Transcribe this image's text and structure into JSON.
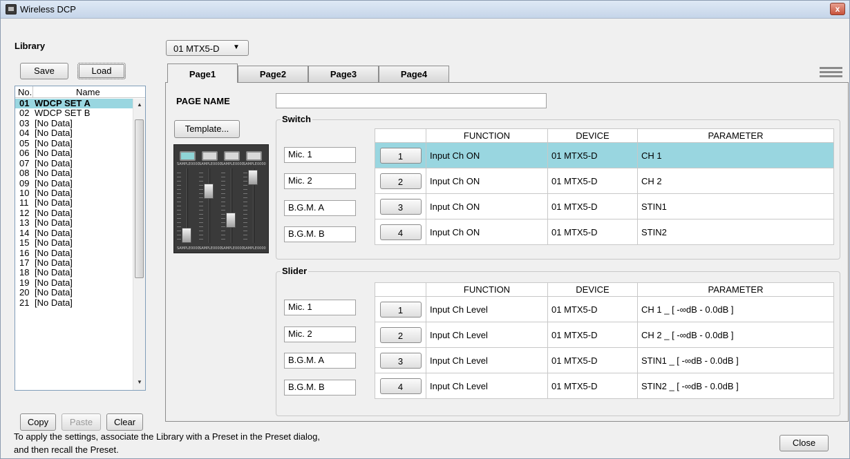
{
  "window": {
    "title": "Wireless DCP",
    "close_glyph": "x"
  },
  "library": {
    "label": "Library",
    "save_label": "Save",
    "load_label": "Load",
    "columns": {
      "no": "No.",
      "name": "Name"
    },
    "items": [
      {
        "no": "01",
        "name": "WDCP SET A"
      },
      {
        "no": "02",
        "name": "WDCP SET B"
      },
      {
        "no": "03",
        "name": "[No Data]"
      },
      {
        "no": "04",
        "name": "[No Data]"
      },
      {
        "no": "05",
        "name": "[No Data]"
      },
      {
        "no": "06",
        "name": "[No Data]"
      },
      {
        "no": "07",
        "name": "[No Data]"
      },
      {
        "no": "08",
        "name": "[No Data]"
      },
      {
        "no": "09",
        "name": "[No Data]"
      },
      {
        "no": "10",
        "name": "[No Data]"
      },
      {
        "no": "11",
        "name": "[No Data]"
      },
      {
        "no": "12",
        "name": "[No Data]"
      },
      {
        "no": "13",
        "name": "[No Data]"
      },
      {
        "no": "14",
        "name": "[No Data]"
      },
      {
        "no": "15",
        "name": "[No Data]"
      },
      {
        "no": "16",
        "name": "[No Data]"
      },
      {
        "no": "17",
        "name": "[No Data]"
      },
      {
        "no": "18",
        "name": "[No Data]"
      },
      {
        "no": "19",
        "name": "[No Data]"
      },
      {
        "no": "20",
        "name": "[No Data]"
      },
      {
        "no": "21",
        "name": "[No Data]"
      }
    ],
    "copy_label": "Copy",
    "paste_label": "Paste",
    "clear_label": "Clear"
  },
  "device_select": {
    "value": "01 MTX5-D",
    "caret": "▼"
  },
  "tabs": [
    {
      "label": "Page1",
      "active": true
    },
    {
      "label": "Page2",
      "active": false
    },
    {
      "label": "Page3",
      "active": false
    },
    {
      "label": "Page4",
      "active": false
    }
  ],
  "page": {
    "page_name_label": "PAGE NAME",
    "page_name_value": "",
    "template_label": "Template...",
    "mixer_pad_text": "SAMPLE0000"
  },
  "switch": {
    "title": "Switch",
    "headers": {
      "function": "FUNCTION",
      "device": "DEVICE",
      "parameter": "PARAMETER"
    },
    "rows": [
      {
        "name": "Mic. 1",
        "num": "1",
        "function": "Input Ch ON",
        "device": "01 MTX5-D",
        "parameter": "CH 1"
      },
      {
        "name": "Mic. 2",
        "num": "2",
        "function": "Input Ch ON",
        "device": "01 MTX5-D",
        "parameter": "CH 2"
      },
      {
        "name": "B.G.M. A",
        "num": "3",
        "function": "Input Ch ON",
        "device": "01 MTX5-D",
        "parameter": "STIN1"
      },
      {
        "name": "B.G.M. B",
        "num": "4",
        "function": "Input Ch ON",
        "device": "01 MTX5-D",
        "parameter": "STIN2"
      }
    ]
  },
  "slider": {
    "title": "Slider",
    "headers": {
      "function": "FUNCTION",
      "device": "DEVICE",
      "parameter": "PARAMETER"
    },
    "rows": [
      {
        "name": "Mic. 1",
        "num": "1",
        "function": "Input Ch Level",
        "device": "01 MTX5-D",
        "parameter": "CH 1 _ [ -∞dB - 0.0dB ]"
      },
      {
        "name": "Mic. 2",
        "num": "2",
        "function": "Input Ch Level",
        "device": "01 MTX5-D",
        "parameter": "CH 2 _ [ -∞dB - 0.0dB ]"
      },
      {
        "name": "B.G.M. A",
        "num": "3",
        "function": "Input Ch Level",
        "device": "01 MTX5-D",
        "parameter": "STIN1 _ [ -∞dB - 0.0dB ]"
      },
      {
        "name": "B.G.M. B",
        "num": "4",
        "function": "Input Ch Level",
        "device": "01 MTX5-D",
        "parameter": "STIN2 _ [ -∞dB - 0.0dB ]"
      }
    ]
  },
  "footer": {
    "line1": "To apply the settings, associate the Library with a Preset in the Preset dialog,",
    "line2": "and then recall the Preset.",
    "close_label": "Close"
  },
  "colors": {
    "selection": "#99d6e0",
    "accent": "#8fd4d6"
  },
  "icons": {
    "app": "app-icon",
    "menu": "hamburger-menu-icon",
    "dropdown": "chevron-down-icon"
  }
}
